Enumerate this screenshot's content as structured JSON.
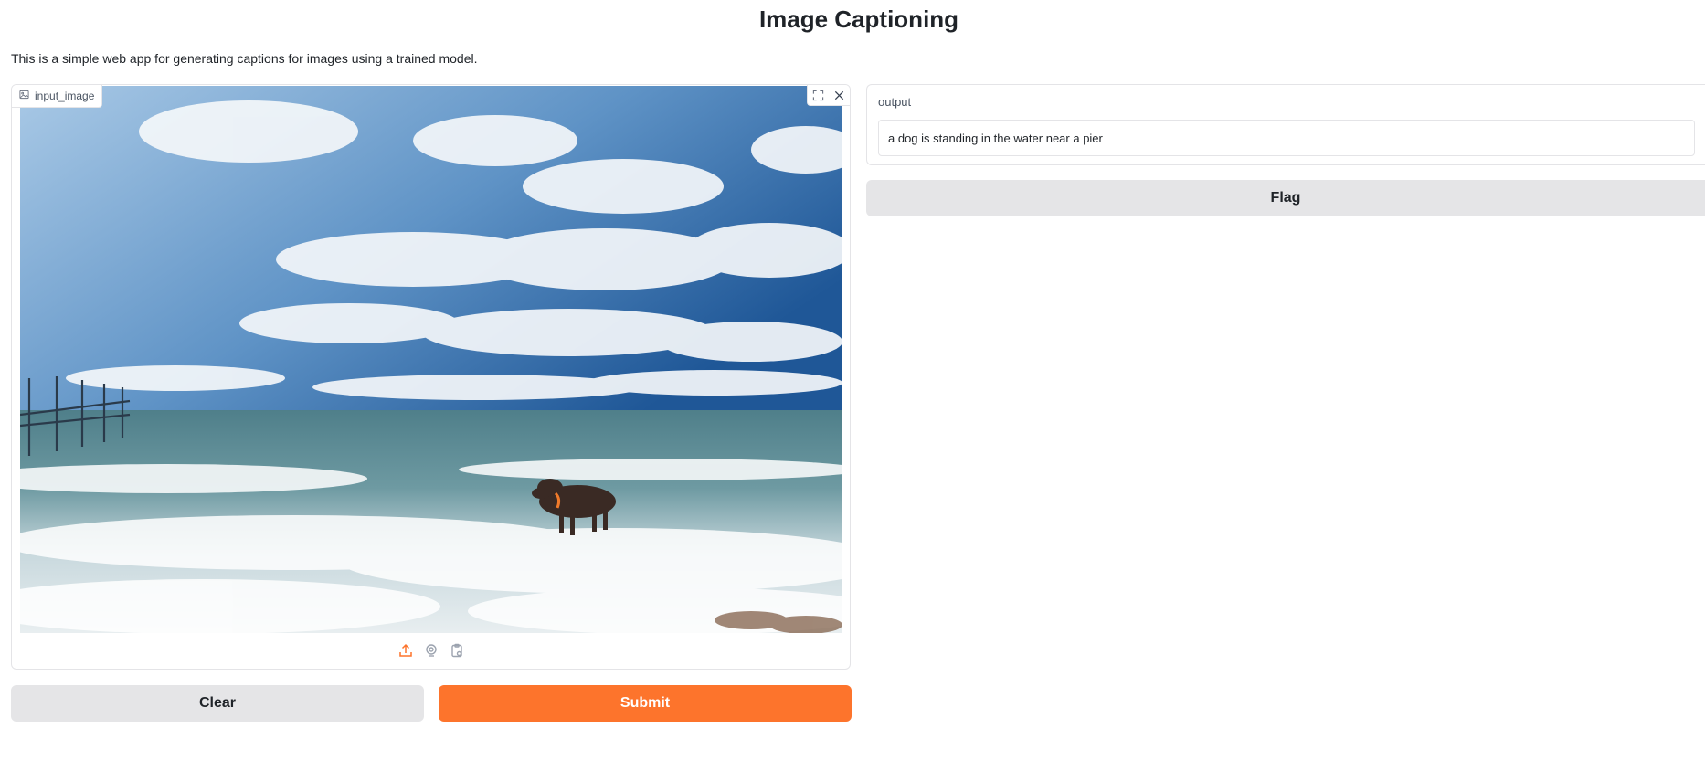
{
  "app": {
    "title": "Image Captioning",
    "description": "This is a simple web app for generating captions for images using a trained model."
  },
  "input_image": {
    "label": "input_image",
    "icons": [
      "image-icon",
      "fullscreen-icon",
      "close-icon",
      "upload-icon",
      "webcam-icon",
      "clipboard-icon"
    ]
  },
  "output": {
    "label": "output",
    "value": "a dog is standing in the water near a pier"
  },
  "buttons": {
    "clear": "Clear",
    "submit": "Submit",
    "flag": "Flag"
  },
  "colors": {
    "accent": "#fd742c",
    "secondary_button": "#e5e5e7"
  }
}
